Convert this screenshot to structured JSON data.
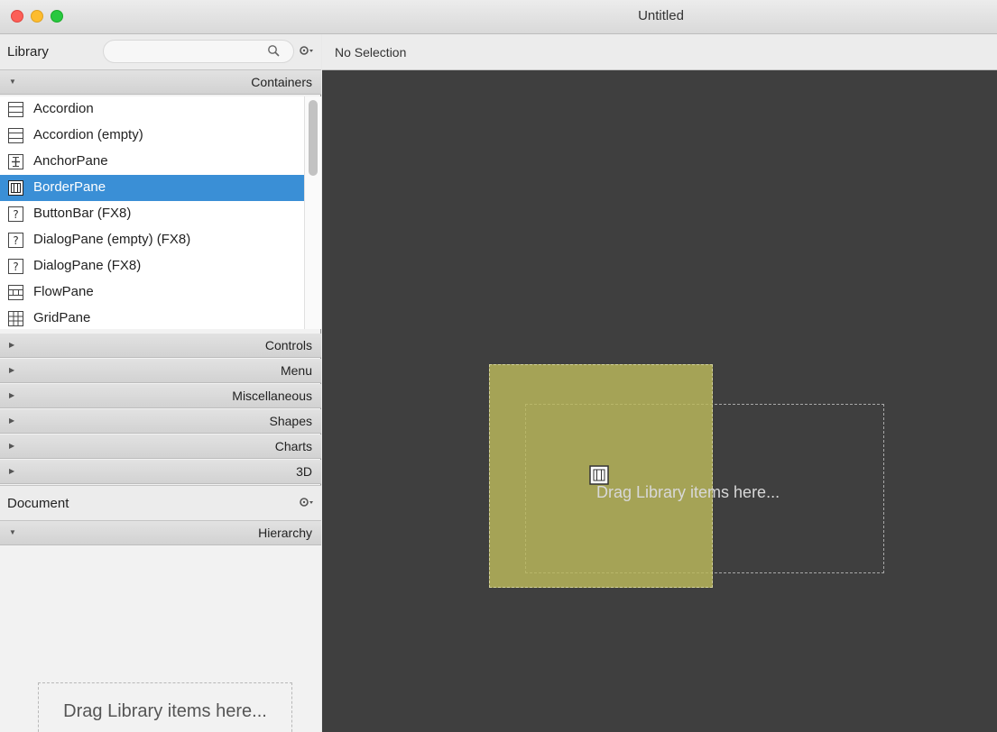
{
  "window": {
    "title": "Untitled"
  },
  "library": {
    "title": "Library",
    "sections": {
      "containers": "Containers",
      "controls": "Controls",
      "menu": "Menu",
      "miscellaneous": "Miscellaneous",
      "shapes": "Shapes",
      "charts": "Charts",
      "threed": "3D"
    },
    "items": [
      {
        "label": "Accordion",
        "icon": "accordion-icon"
      },
      {
        "label": "Accordion  (empty)",
        "icon": "accordion-icon"
      },
      {
        "label": "AnchorPane",
        "icon": "anchor-pane-icon"
      },
      {
        "label": "BorderPane",
        "icon": "border-pane-icon",
        "selected": true
      },
      {
        "label": "ButtonBar  (FX8)",
        "icon": "question-icon"
      },
      {
        "label": "DialogPane (empty)  (FX8)",
        "icon": "question-icon"
      },
      {
        "label": "DialogPane  (FX8)",
        "icon": "question-icon"
      },
      {
        "label": "FlowPane",
        "icon": "flow-pane-icon"
      },
      {
        "label": "GridPane",
        "icon": "grid-pane-icon"
      }
    ]
  },
  "document": {
    "title": "Document",
    "hierarchy": "Hierarchy",
    "drop_hint": "Drag Library items here..."
  },
  "canvas": {
    "selection": "No Selection",
    "drop_hint": "Drag Library items here..."
  },
  "colors": {
    "selected_row": "#3a8fd6",
    "canvas_bg": "#3f3f3f",
    "drop_highlight": "#bcba5c"
  }
}
